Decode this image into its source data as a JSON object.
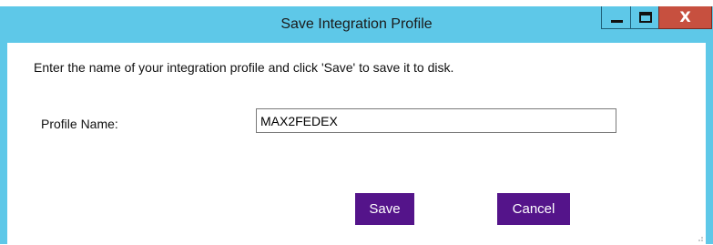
{
  "window": {
    "title": "Save Integration Profile",
    "close_glyph": "X"
  },
  "form": {
    "instructions": "Enter the name of your integration profile and click 'Save' to save it to disk.",
    "profile_name_label": "Profile Name:",
    "profile_name_value": "MAX2FEDEX"
  },
  "buttons": {
    "save_label": "Save",
    "cancel_label": "Cancel"
  },
  "icons": {
    "minimize": "minimize-icon",
    "maximize": "maximize-icon",
    "close": "close-icon",
    "resize_grip": "resize-grip-icon"
  },
  "colors": {
    "titlebar": "#5ec8e8",
    "close_button": "#c7503f",
    "action_button": "#54148a"
  }
}
